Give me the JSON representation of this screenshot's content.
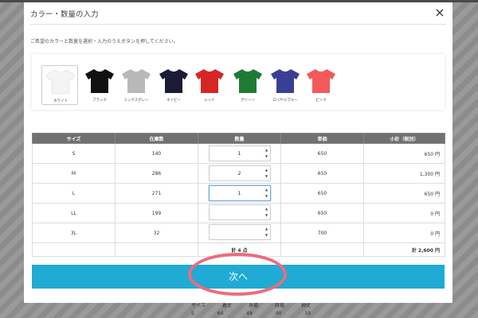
{
  "background_table": {
    "header": [
      "サイズ",
      "着丈",
      "身幅",
      "肩幅",
      "袖丈"
    ],
    "row": [
      "S",
      "64",
      "48",
      "40",
      "19"
    ]
  },
  "modal": {
    "title": "カラー・数量の入力",
    "close_label": "×",
    "instruction": "ご希望のカラーと数量を選択・入力のうえボタンを押してください。"
  },
  "colors": [
    {
      "label": "ホワイト",
      "hex": "#f4f4f4",
      "selected": true
    },
    {
      "label": "ブラック",
      "hex": "#111111",
      "selected": false
    },
    {
      "label": "ミックスグレー",
      "hex": "#b8b8b8",
      "selected": false
    },
    {
      "label": "ネイビー",
      "hex": "#1b1b35",
      "selected": false
    },
    {
      "label": "レッド",
      "hex": "#d72525",
      "selected": false
    },
    {
      "label": "グリーン",
      "hex": "#1f7a36",
      "selected": false
    },
    {
      "label": "ロイヤルブルー",
      "hex": "#3a3f96",
      "selected": false
    },
    {
      "label": "ピンク",
      "hex": "#f25a5a",
      "selected": false
    }
  ],
  "table": {
    "headers": [
      "サイズ",
      "在庫数",
      "数量",
      "単価",
      "小計（税別）"
    ],
    "rows": [
      {
        "size": "S",
        "stock": "140",
        "qty": "1",
        "price": "650",
        "subtotal": "650 円"
      },
      {
        "size": "M",
        "stock": "286",
        "qty": "2",
        "price": "650",
        "subtotal": "1,300 円"
      },
      {
        "size": "L",
        "stock": "271",
        "qty": "1",
        "price": "650",
        "subtotal": "650 円"
      },
      {
        "size": "LL",
        "stock": "199",
        "qty": "",
        "price": "650",
        "subtotal": "0 円"
      },
      {
        "size": "3L",
        "stock": "32",
        "qty": "",
        "price": "700",
        "subtotal": "0 円"
      }
    ],
    "total_qty": "計 4 点",
    "total_amount": "計 2,600 円"
  },
  "next_button_label": "次へ",
  "accent_colors": {
    "button": "#1fabd3",
    "highlight_ring": "#ef6b7d",
    "table_header": "#707070"
  }
}
